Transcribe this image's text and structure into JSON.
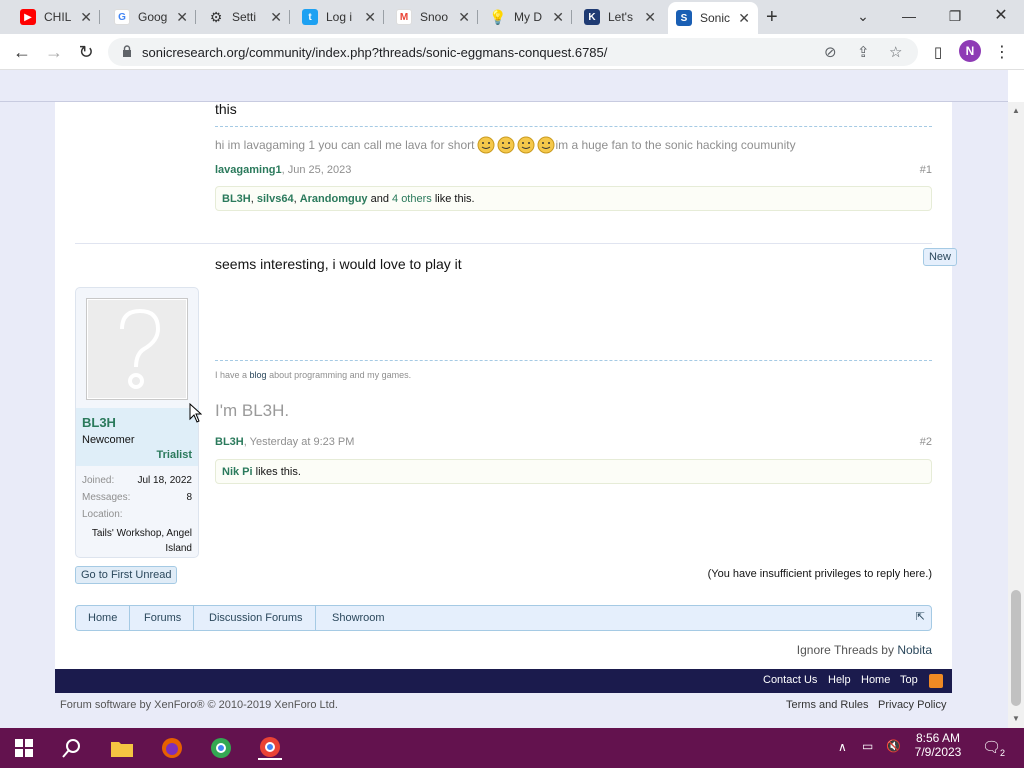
{
  "browser": {
    "tabs": [
      {
        "label": "CHIL",
        "favicon": "youtube-icon",
        "color": "#ff0000"
      },
      {
        "label": "Goog",
        "favicon": "google-icon",
        "color": "#4285f4"
      },
      {
        "label": "Setti",
        "favicon": "settings-icon",
        "color": "#333333"
      },
      {
        "label": "Log i",
        "favicon": "twitter-icon",
        "color": "#1da1f2"
      },
      {
        "label": "Snoo",
        "favicon": "gmail-icon",
        "color": "#ea4335"
      },
      {
        "label": "My D",
        "favicon": "lightbulb-icon",
        "color": "#f4b400"
      },
      {
        "label": "Let's",
        "favicon": "site-icon",
        "color": "#1f3b73"
      },
      {
        "label": "Sonic",
        "favicon": "sonic-icon",
        "color": "#1a5fb4",
        "active": true
      }
    ],
    "url": "sonicresearch.org/community/index.php?threads/sonic-eggmans-conquest.6785/",
    "profile_initial": "N"
  },
  "post1": {
    "text_top": "this",
    "signature": "hi im lavagaming 1 you can call me lava for short",
    "signature_after": "im a huge fan to the sonic hacking coumunity",
    "author": "lavagaming1",
    "date": "Jun 25, 2023",
    "number": "#1",
    "likes": {
      "names": [
        "BL3H",
        "silvs64",
        "Arandomguy"
      ],
      "and": "and",
      "others": "4 others",
      "suffix": "like this."
    }
  },
  "post2": {
    "badge": "New",
    "text": "seems interesting, i would love to play it",
    "sig_prefix": "I have a",
    "sig_link": "blog",
    "sig_suffix": "about programming and my games.",
    "sig_big": "I'm BL3H.",
    "author": "BL3H",
    "date": "Yesterday at 9:23 PM",
    "number": "#2",
    "likes": {
      "name": "Nik Pi",
      "suffix": "likes this."
    },
    "user": {
      "name": "BL3H",
      "title": "Newcomer",
      "banner": "Trialist",
      "joined_label": "Joined:",
      "joined": "Jul 18, 2022",
      "messages_label": "Messages:",
      "messages": "8",
      "location_label": "Location:",
      "location": "Tails' Workshop, Angel Island"
    }
  },
  "actions": {
    "first_unread": "Go to First Unread",
    "reply_notice": "(You have insufficient privileges to reply here.)"
  },
  "breadcrumb": [
    "Home",
    "Forums",
    "Discussion Forums",
    "Showroom"
  ],
  "ignore": {
    "prefix": "Ignore Threads by",
    "link": "Nobita"
  },
  "footer": {
    "links": [
      "Contact Us",
      "Help",
      "Home",
      "Top"
    ],
    "copyright": "Forum software by XenForo® © 2010-2019 XenForo Ltd.",
    "terms": "Terms and Rules",
    "privacy": "Privacy Policy"
  },
  "taskbar": {
    "time": "8:56 AM",
    "date": "7/9/2023",
    "notifications": "2"
  }
}
